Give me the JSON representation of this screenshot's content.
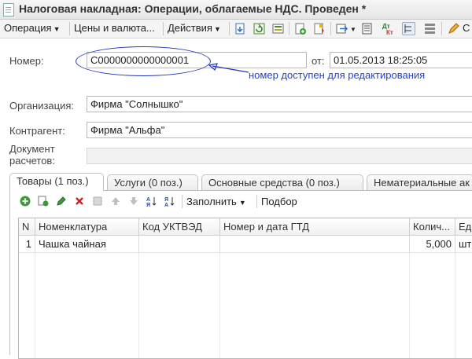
{
  "window": {
    "title": "Налоговая накладная: Операции, облагаемые НДС. Проведен *"
  },
  "toolbar": {
    "operation_label": "Операция",
    "prices_label": "Цены и валюта...",
    "actions_label": "Действия"
  },
  "header": {
    "number_label": "Номер:",
    "number_value": "С0000000000000001",
    "date_label": "от:",
    "date_value": "01.05.2013 18:25:05",
    "annotation": "номер доступен для редактирования",
    "organization_label": "Организация:",
    "organization_value": "Фирма \"Солнышко\"",
    "counterparty_label": "Контрагент:",
    "counterparty_value": "Фирма \"Альфа\"",
    "settlement_label_line1": "Документ",
    "settlement_label_line2": "расчетов:",
    "settlement_value": ""
  },
  "tabs": [
    {
      "label": "Товары (1 поз.)"
    },
    {
      "label": "Услуги (0 поз.)"
    },
    {
      "label": "Основные средства (0 поз.)"
    },
    {
      "label": "Нематериальные ак"
    }
  ],
  "goods_toolbar": {
    "fill_label": "Заполнить",
    "select_label": "Подбор"
  },
  "grid": {
    "columns": [
      "N",
      "Номенклатура",
      "Код УКТВЭД",
      "Номер и дата ГТД",
      "Колич...",
      "Ед."
    ],
    "rows": [
      {
        "n": "1",
        "item": "Чашка чайная",
        "code": "",
        "gtd": "",
        "qty": "5,000",
        "unit": "шт"
      }
    ]
  },
  "colors": {
    "annotation_blue": "#2244cc",
    "ellipse_blue": "#2233bb"
  }
}
